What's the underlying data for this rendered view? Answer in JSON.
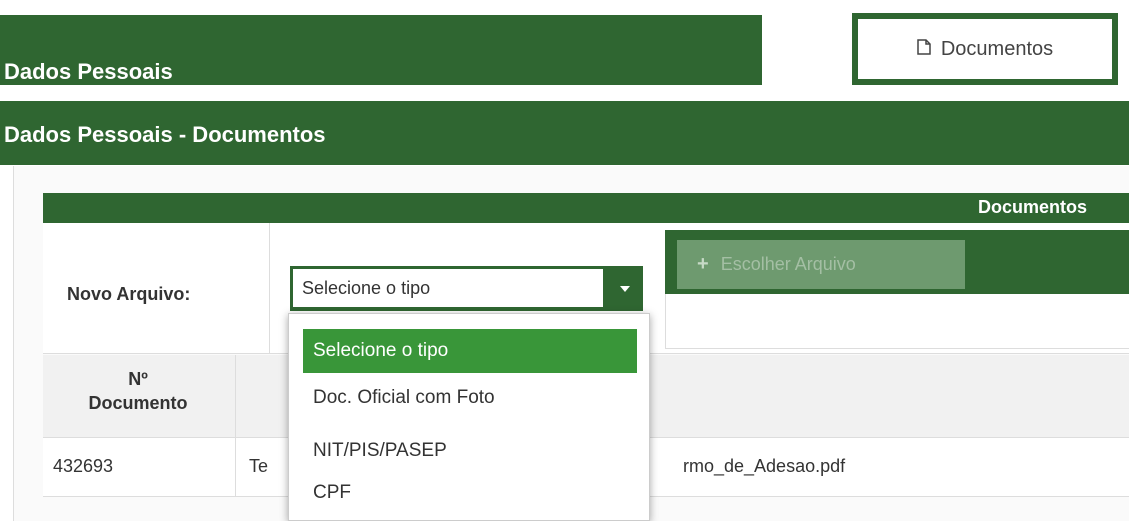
{
  "header": {
    "section_title": "Dados Pessoais",
    "documents_button": "Documentos",
    "documents_icon": "file-icon"
  },
  "subheader": {
    "title": "Dados Pessoais - Documentos"
  },
  "documents_table": {
    "title": "Documentos",
    "new_file_label": "Novo Arquivo:",
    "type_select": {
      "selected": "Selecione o tipo",
      "options": [
        "Selecione o tipo",
        "Doc. Oficial com Foto",
        "NIT/PIS/PASEP",
        "CPF"
      ]
    },
    "choose_file_button": "Escolher Arquivo",
    "choose_file_icon": "plus-icon",
    "columns": {
      "number_line1": "Nº",
      "number_line2": "Documento"
    },
    "rows": [
      {
        "number": "432693",
        "name_left": "Te",
        "name_right": "rmo_de_Adesao.pdf"
      }
    ]
  },
  "colors": {
    "primary": "#2f6631",
    "selected_option": "#399639"
  }
}
